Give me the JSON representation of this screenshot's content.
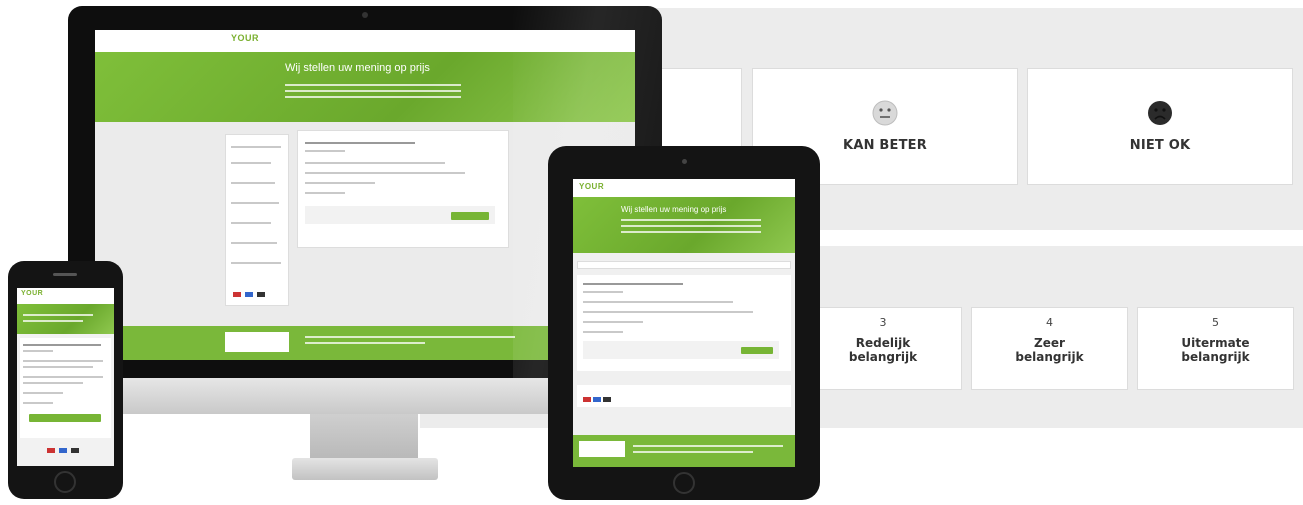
{
  "devices": {
    "brand_logo": "YOUR",
    "headline": "Wij stellen uw mening op prijs"
  },
  "mood_options": [
    {
      "label": "KAN BETER",
      "icon": "neutral-face-icon"
    },
    {
      "label": "NIET OK",
      "icon": "sad-face-icon"
    }
  ],
  "importance_scale": [
    {
      "number": "3",
      "line1": "Redelijk",
      "line2": "belangrijk"
    },
    {
      "number": "4",
      "line1": "Zeer",
      "line2": "belangrijk"
    },
    {
      "number": "5",
      "line1": "Uitermate",
      "line2": "belangrijk"
    }
  ],
  "colors": {
    "brand_green": "#77b535",
    "panel_gray": "#ececec",
    "device_black": "#141414"
  }
}
